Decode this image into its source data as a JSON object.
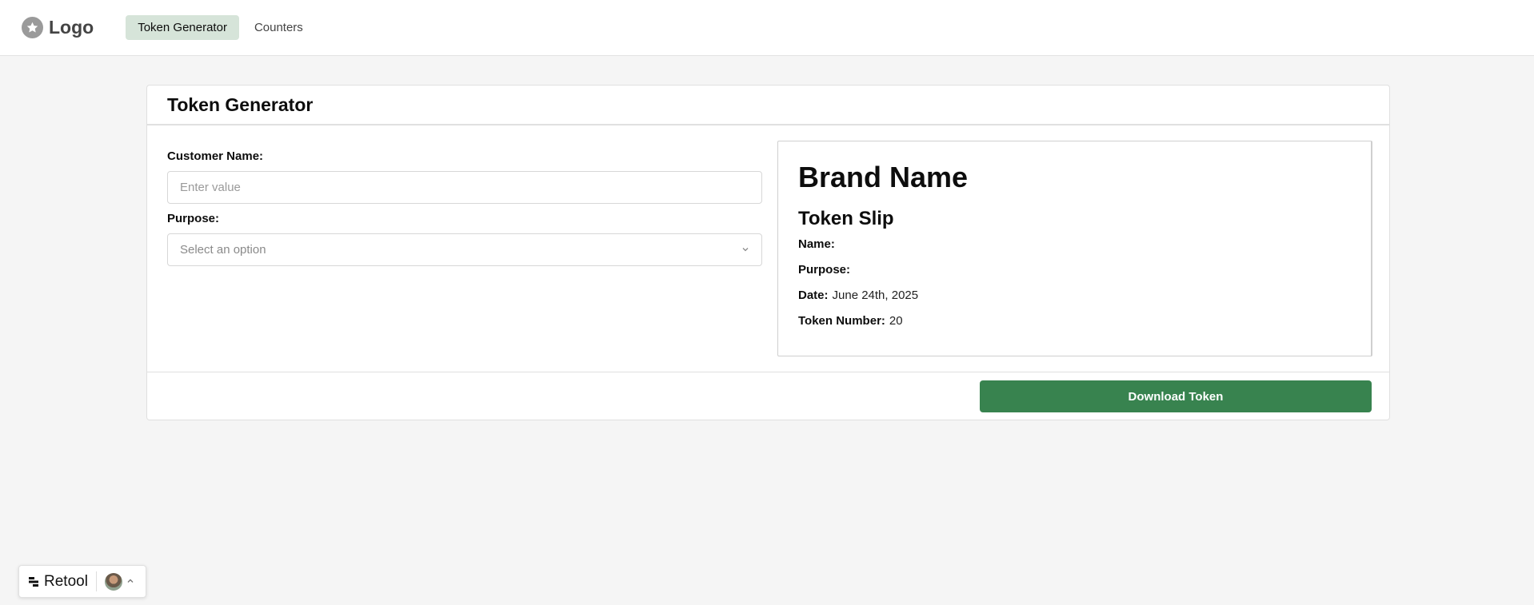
{
  "header": {
    "logo_text": "Logo",
    "nav_tabs": [
      {
        "label": "Token Generator",
        "active": true
      },
      {
        "label": "Counters",
        "active": false
      }
    ]
  },
  "card": {
    "title": "Token Generator",
    "form": {
      "customer_label": "Customer Name:",
      "customer_placeholder": "Enter value",
      "customer_value": "",
      "purpose_label": "Purpose:",
      "purpose_placeholder": "Select an option"
    },
    "slip": {
      "brand": "Brand Name",
      "title": "Token Slip",
      "name_key": "Name:",
      "name_value": "",
      "purpose_key": "Purpose:",
      "purpose_value": "",
      "date_key": "Date:",
      "date_value": "June 24th, 2025",
      "token_key": "Token Number:",
      "token_value": "20"
    },
    "download_label": "Download Token"
  },
  "retool_badge": {
    "label": "Retool"
  },
  "colors": {
    "accent": "#38834f",
    "active_tab_bg": "#d6e4d9",
    "page_bg": "#f5f5f5"
  },
  "icons": [
    "star-icon",
    "chevron-down-icon",
    "retool-icon",
    "avatar",
    "chevron-up-icon"
  ]
}
